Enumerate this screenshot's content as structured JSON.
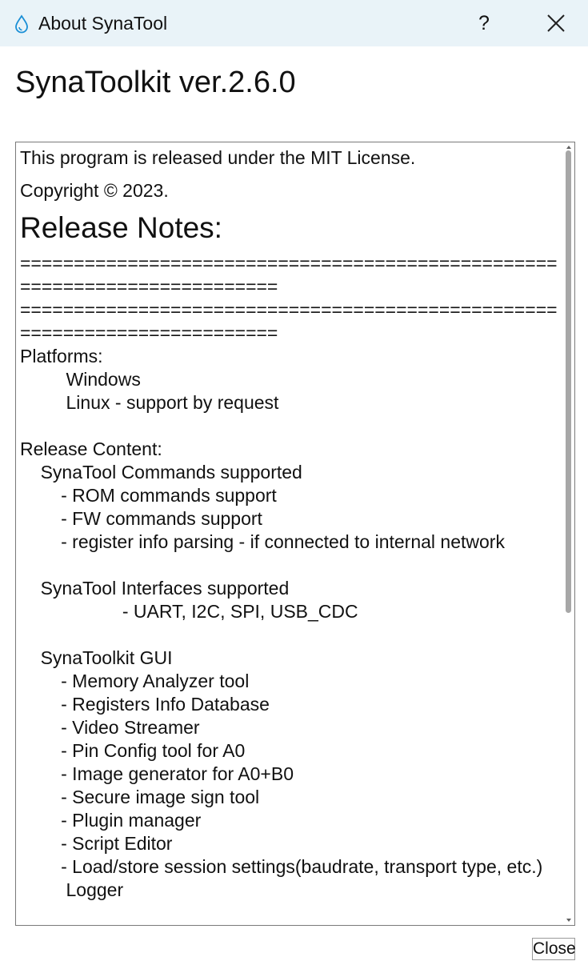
{
  "window": {
    "title": "About SynaTool",
    "help_label": "?",
    "icon": "water-drop-icon",
    "close_icon": "close-icon"
  },
  "heading": "SynaToolkit ver.2.6.0",
  "content": {
    "license": "This program is released under the MIT License.",
    "copyright": "Copyright © 2023.",
    "notes_title": "Release Notes:",
    "notes_body": "==========================================================================\n==========================================================================\nPlatforms:\n         Windows\n         Linux - support by request\n\nRelease Content:\n    SynaTool Commands supported\n        - ROM commands support\n        - FW commands support\n        - register info parsing - if connected to internal network\n\n    SynaTool Interfaces supported\n                    - UART, I2C, SPI, USB_CDC\n\n    SynaToolkit GUI\n        - Memory Analyzer tool\n        - Registers Info Database\n        - Video Streamer\n        - Pin Config tool for A0\n        - Image generator for A0+B0\n        - Secure image sign tool\n        - Plugin manager\n        - Script Editor\n        - Load/store session settings(baudrate, transport type, etc.)\n         Logger"
  },
  "buttons": {
    "close": "Close"
  }
}
